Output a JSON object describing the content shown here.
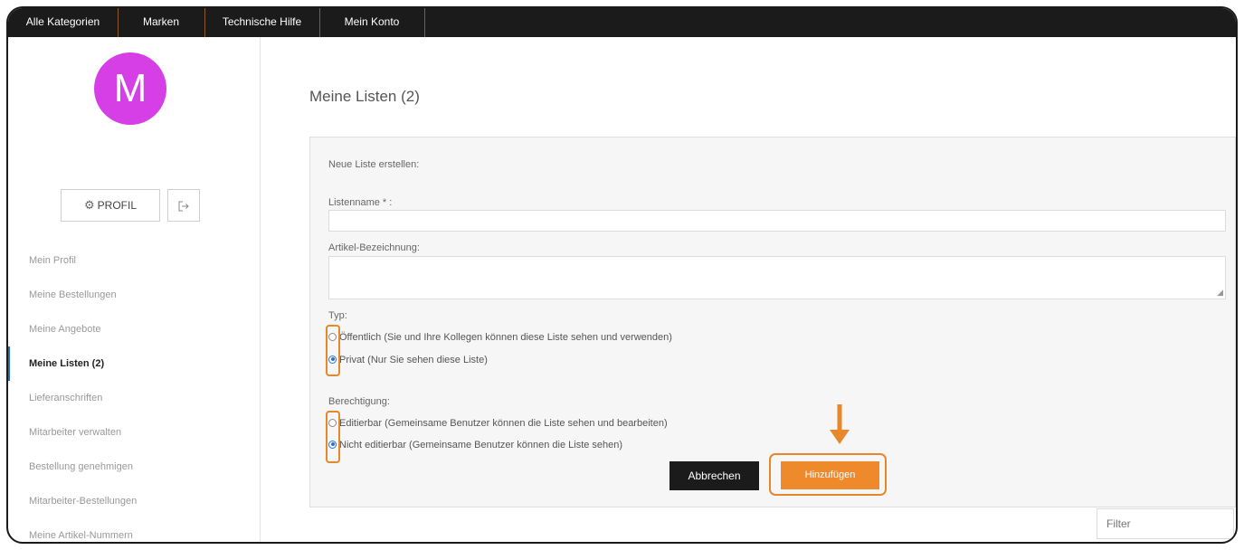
{
  "topnav": {
    "items": [
      "Alle Kategorien",
      "Marken",
      "Technische Hilfe",
      "Mein Konto"
    ]
  },
  "sidebar": {
    "avatar_letter": "M",
    "avatar_color": "#d63fe6",
    "profile_button": "PROFIL",
    "menu": [
      {
        "label": "Mein Profil",
        "active": false
      },
      {
        "label": "Meine Bestellungen",
        "active": false
      },
      {
        "label": "Meine Angebote",
        "active": false
      },
      {
        "label": "Meine Listen (2)",
        "active": true
      },
      {
        "label": "Lieferanschriften",
        "active": false
      },
      {
        "label": "Mitarbeiter verwalten",
        "active": false
      },
      {
        "label": "Bestellung genehmigen",
        "active": false
      },
      {
        "label": "Mitarbeiter-Bestellungen",
        "active": false
      },
      {
        "label": "Meine Artikel-Nummern",
        "active": false
      }
    ]
  },
  "main": {
    "title": "Meine Listen (2)",
    "form": {
      "heading": "Neue Liste erstellen:",
      "name_label": "Listenname * :",
      "name_value": "",
      "description_label": "Artikel-Bezeichnung:",
      "description_value": "",
      "type_label": "Typ:",
      "type_options": [
        {
          "label": "Öffentlich (Sie und Ihre Kollegen können diese Liste sehen und verwenden)",
          "checked": false
        },
        {
          "label": "Privat (Nur Sie sehen diese Liste)",
          "checked": true
        }
      ],
      "permission_label": "Berechtigung:",
      "permission_options": [
        {
          "label": "Editierbar (Gemeinsame Benutzer können die Liste sehen und bearbeiten)",
          "checked": false
        },
        {
          "label": "Nicht editierbar (Gemeinsame Benutzer können die Liste sehen)",
          "checked": true
        }
      ],
      "cancel_button": "Abbrechen",
      "add_button": "Hinzufügen"
    },
    "filter_placeholder": "Filter"
  },
  "colors": {
    "accent_orange": "#ee8a2c",
    "highlight_orange": "#e8862a",
    "nav_dark": "#1b1b1b",
    "radio_blue": "#2a72d8"
  }
}
